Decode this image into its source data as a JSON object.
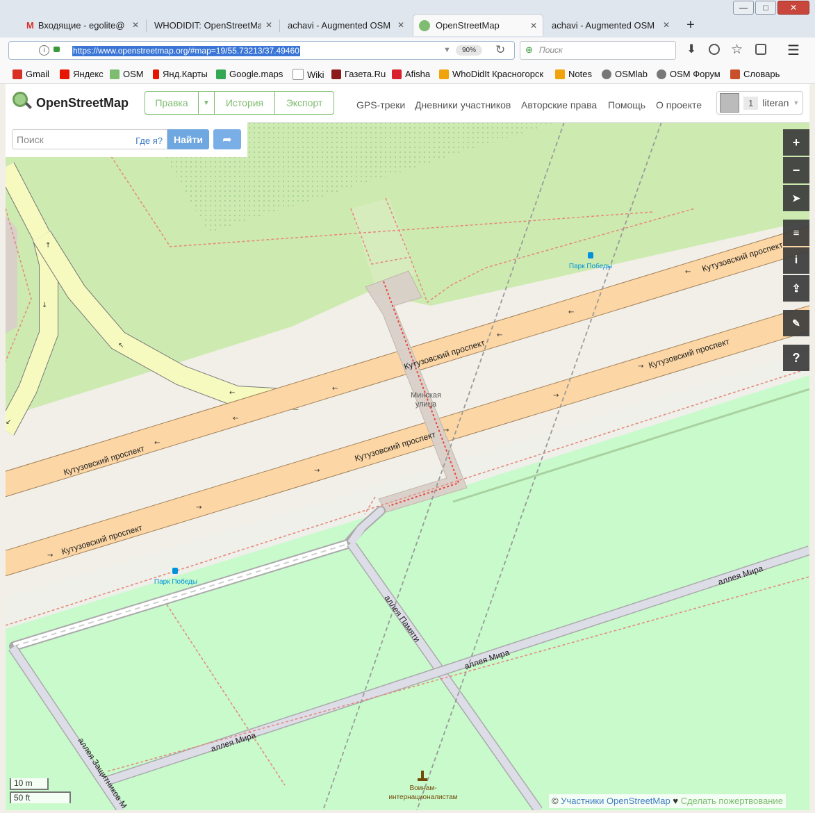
{
  "browser": {
    "tabs": [
      {
        "title": "Входящие - egolite@",
        "close": "✕"
      },
      {
        "title": "WHODIDIT: OpenStreetMa",
        "close": "✕"
      },
      {
        "title": "achavi - Augmented OSM",
        "close": "✕"
      },
      {
        "title": "OpenStreetMap",
        "close": "✕"
      },
      {
        "title": "achavi - Augmented OSM",
        "close": "✕"
      }
    ],
    "new_tab": "+",
    "window_buttons": {
      "minimize": "—",
      "maximize": "□",
      "close": "✕"
    },
    "url": "https://www.openstreetmap.org/#map=19/55.73213/37.49460",
    "zoom": "90%",
    "search_placeholder": "Поиск",
    "bookmarks": [
      {
        "label": "Gmail",
        "color": "#d93025"
      },
      {
        "label": "Яндекс",
        "color": "#e61400"
      },
      {
        "label": "OSM",
        "color": "#7ebc6f"
      },
      {
        "label": "Янд.Карты",
        "color": "#e61400"
      },
      {
        "label": "Google.maps",
        "color": "#34a853"
      },
      {
        "label": "Wiki",
        "color": "#222222"
      },
      {
        "label": "Газета.Ru",
        "color": "#8b1a1a"
      },
      {
        "label": "Afisha",
        "color": "#d8202f"
      },
      {
        "label": "WhoDidIt Красногорск",
        "color": "#f0a30a"
      },
      {
        "label": "Notes",
        "color": "#f0a30a"
      },
      {
        "label": "OSMlab",
        "color": "#777777"
      },
      {
        "label": "OSM Форум",
        "color": "#777777"
      },
      {
        "label": "Словарь",
        "color": "#c8502a"
      }
    ]
  },
  "osm": {
    "brand": "OpenStreetMap",
    "edit": "Правка",
    "history": "История",
    "export": "Экспорт",
    "nav": [
      "GPS-треки",
      "Дневники участников",
      "Авторские права",
      "Помощь",
      "О проекте"
    ],
    "user_count": "1",
    "username": "literan",
    "search_placeholder": "Поиск",
    "where_am_i": "Где я?",
    "go": "Найти",
    "brand_color": "#7ebc6f"
  },
  "map": {
    "streets": {
      "kutuzovsky": "Кутузовский проспект",
      "minskaya": [
        "Минская",
        "улица"
      ],
      "alleya_mira": "аллея Мира",
      "alleya_pamyati": "аллея Памяти",
      "alleya_zashchitnikov": "аллея Защитников М"
    },
    "bus_stop": "Парк Победы",
    "monument": [
      "Воинам-",
      "интернационалистам"
    ],
    "scale": {
      "metric": "10 m",
      "imperial": "50 ft"
    },
    "attribution_prefix": "©",
    "attribution_contributors": "Участники OpenStreetMap",
    "attribution_heart": "♥",
    "attribution_donate": "Сделать пожертвование"
  }
}
